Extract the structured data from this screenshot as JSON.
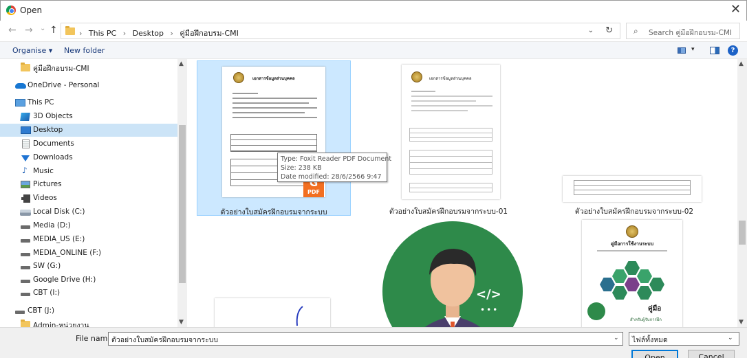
{
  "window": {
    "title": "Open",
    "close_glyph": "✕"
  },
  "nav": {
    "back": "←",
    "forward": "→",
    "recent": "⌄",
    "up": "↑"
  },
  "address": {
    "crumbs": [
      "This PC",
      "Desktop",
      "คู่มือฝึกอบรม-CMI"
    ],
    "separator": "›",
    "dropdown_glyph": "⌄",
    "refresh_glyph": "↻"
  },
  "search": {
    "placeholder": "Search คู่มือฝึกอบรม-CMI",
    "icon": "search-icon"
  },
  "toolbar": {
    "organise_label": "Organise ▾",
    "new_folder_label": "New folder",
    "view_chevron": "▾",
    "help_glyph": "?"
  },
  "sidebar": {
    "items": [
      {
        "label": "คู่มือฝึกอบรม-CMI",
        "icon": "folder-icon"
      },
      {
        "label": "OneDrive - Personal",
        "icon": "onedrive-icon"
      },
      {
        "label": "This PC",
        "icon": "computer-icon"
      },
      {
        "label": "3D Objects",
        "icon": "3d-objects-icon"
      },
      {
        "label": "Desktop",
        "icon": "desktop-icon",
        "selected": true
      },
      {
        "label": "Documents",
        "icon": "documents-icon"
      },
      {
        "label": "Downloads",
        "icon": "downloads-icon"
      },
      {
        "label": "Music",
        "icon": "music-icon"
      },
      {
        "label": "Pictures",
        "icon": "pictures-icon"
      },
      {
        "label": "Videos",
        "icon": "videos-icon"
      },
      {
        "label": "Local Disk (C:)",
        "icon": "local-disk-icon"
      },
      {
        "label": "Media (D:)",
        "icon": "drive-icon"
      },
      {
        "label": "MEDIA_US (E:)",
        "icon": "drive-icon"
      },
      {
        "label": "MEDIA_ONLINE (F:)",
        "icon": "drive-icon"
      },
      {
        "label": "SW (G:)",
        "icon": "drive-icon"
      },
      {
        "label": "Google Drive (H:)",
        "icon": "drive-icon"
      },
      {
        "label": "CBT (I:)",
        "icon": "drive-icon"
      },
      {
        "label": "CBT (J:)",
        "icon": "drive-icon"
      },
      {
        "label": "Admin-หน่วยงาน",
        "icon": "folder-icon"
      }
    ]
  },
  "files": [
    {
      "name": "ตัวอย่างใบสมัครฝึกอบรมจากระบบ",
      "selected": true,
      "doc_title": "เอกสารข้อมูลส่วนบุคคล"
    },
    {
      "name": "ตัวอย่างใบสมัครฝึกอบรมจากระบบ-01",
      "doc_title": "เอกสารข้อมูลส่วนบุคคล"
    },
    {
      "name": "ตัวอย่างใบสมัครฝึกอบรมจากระบบ-02"
    },
    {
      "name": ""
    },
    {
      "name": ""
    },
    {
      "name": ""
    }
  ],
  "cmi_doc": {
    "title": "คู่มือการใช้งานระบบ",
    "subtitle": "คู่มือ",
    "caption": "สำหรับผู้รับการฝึก"
  },
  "avatar_code_glyph": "</>",
  "avatar_dots": "•••",
  "pdf_badge": {
    "glyph": "G",
    "label": "PDF"
  },
  "tooltip": {
    "type": "Type: Foxit Reader PDF Document",
    "size": "Size: 238 KB",
    "modified": "Date modified: 28/6/2566 9:47"
  },
  "footer": {
    "file_name_label": "File name:",
    "file_name_value": "ตัวอย่างใบสมัครฝึกอบรมจากระบบ",
    "file_type_value": "ไฟล์ทั้งหมด",
    "dropdown_glyph": "⌄",
    "open_label": "Open",
    "cancel_label": "Cancel"
  },
  "scroll": {
    "up_glyph": "▲",
    "down_glyph": "▼"
  },
  "colors": {
    "selection": "#cce4f7",
    "accent": "#0078d7",
    "folder": "#f2c55c",
    "pdf": "#f26f21"
  }
}
